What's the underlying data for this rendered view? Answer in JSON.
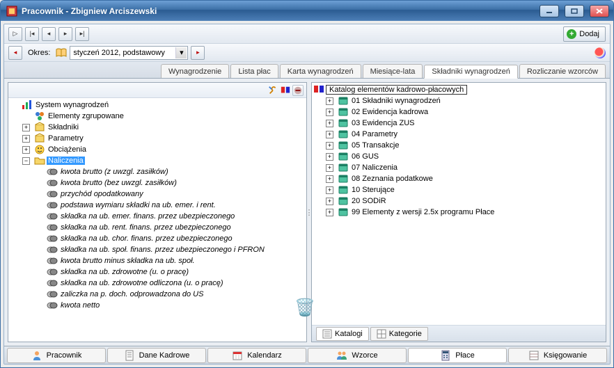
{
  "window": {
    "title": "Pracownik - Zbigniew Arciszewski"
  },
  "toolbar": {
    "add_label": "Dodaj",
    "period_label": "Okres:",
    "period_value": "styczeń 2012, podstawowy"
  },
  "top_tabs": [
    {
      "label": "Wynagrodzenie",
      "active": false
    },
    {
      "label": "Lista płac",
      "active": false
    },
    {
      "label": "Karta wynagrodzeń",
      "active": false
    },
    {
      "label": "Miesiące-lata",
      "active": false
    },
    {
      "label": "Składniki wynagrodzeń",
      "active": true
    },
    {
      "label": "Rozliczanie wzorców",
      "active": false
    }
  ],
  "left_tree": {
    "root": "System wynagrodzeń",
    "root_children": [
      {
        "label": "Elementy zgrupowane",
        "toggle": "",
        "icon": "grouped"
      },
      {
        "label": "Składniki",
        "toggle": "+",
        "icon": "box"
      },
      {
        "label": "Parametry",
        "toggle": "+",
        "icon": "box"
      },
      {
        "label": "Obciążenia",
        "toggle": "+",
        "icon": "face"
      },
      {
        "label": "Naliczenia",
        "toggle": "-",
        "icon": "folder",
        "selected": true
      }
    ],
    "naliczenia_children": [
      "kwota brutto (z uwzgl. zasiłków)",
      "kwota brutto (bez uwzgl. zasiłków)",
      "przychód opodatkowany",
      "podstawa wymiaru składki na ub. emer. i rent.",
      "składka na ub. emer. finans. przez ubezpieczonego",
      "składka na ub. rent. finans. przez ubezpieczonego",
      "składka na ub. chor. finans. przez ubezpieczonego",
      "składka na ub. społ. finans. przez ubezpieczonego i PFRON",
      "kwota brutto minus składka na ub. społ.",
      "składka na ub. zdrowotne (u. o pracę)",
      "składka na ub. zdrowotne odliczona (u. o pracę)",
      "zaliczka na p. doch. odprowadzona do US",
      "kwota netto"
    ]
  },
  "right_tree": {
    "header": "Katalog elementów kadrowo-płacowych",
    "items": [
      "01 Składniki wynagrodzeń",
      "02 Ewidencja kadrowa",
      "03 Ewidencja ZUS",
      "04 Parametry",
      "05 Transakcje",
      "06 GUS",
      "07 Naliczenia",
      "08 Zeznania podatkowe",
      "10 Sterujące",
      "20 SODiR",
      "99 Elementy z wersji 2.5x programu Płace"
    ]
  },
  "sub_tabs": [
    {
      "label": "Katalogi",
      "active": true
    },
    {
      "label": "Kategorie",
      "active": false
    }
  ],
  "bottom_tabs": [
    {
      "label": "Pracownik",
      "icon": "person"
    },
    {
      "label": "Dane Kadrowe",
      "icon": "sheet"
    },
    {
      "label": "Kalendarz",
      "icon": "calendar"
    },
    {
      "label": "Wzorce",
      "icon": "people"
    },
    {
      "label": "Płace",
      "icon": "calc",
      "active": true
    },
    {
      "label": "Księgowanie",
      "icon": "ledger"
    }
  ]
}
